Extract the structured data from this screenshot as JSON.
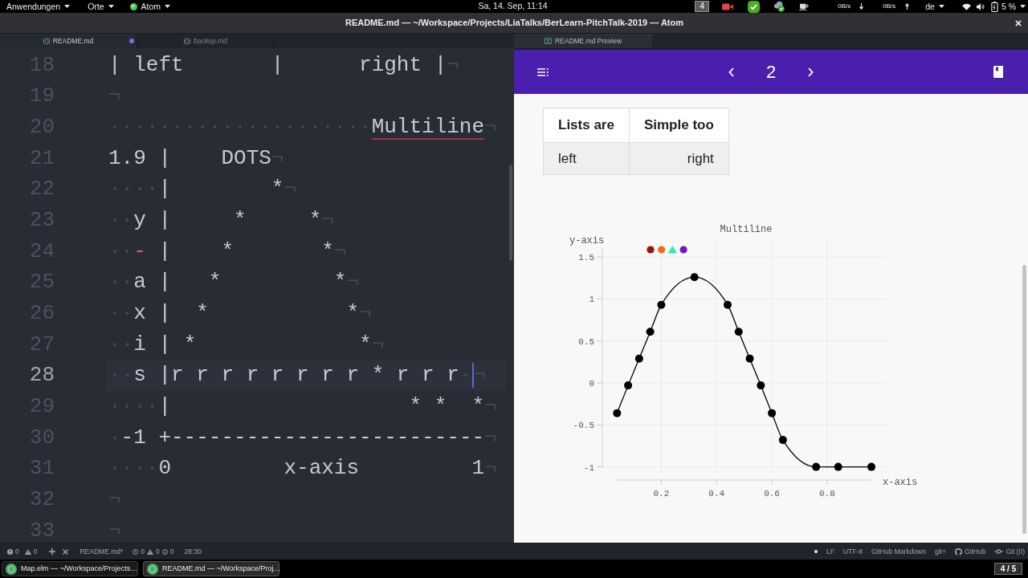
{
  "top_bar": {
    "menus": [
      {
        "label": "Anwendungen",
        "kind": "plain"
      },
      {
        "label": "Orte",
        "kind": "plain"
      },
      {
        "label": "Atom",
        "kind": "app"
      }
    ],
    "clock": "Sa, 14. Sep, 11:14",
    "workspace": "4",
    "download_rate": "0B/s",
    "upload_rate": "0B/s",
    "keyboard_layout": "de",
    "battery": "5 %"
  },
  "window": {
    "title": "README.md — ~/Workspace/Projects/LiaTalks/BerLearn-PitchTalk-2019 — Atom"
  },
  "editor": {
    "tabs": [
      {
        "label": "README.md",
        "selected": true,
        "modified": true,
        "pending": false
      },
      {
        "label": "backup.md",
        "selected": false,
        "modified": false,
        "pending": true
      }
    ],
    "lines": [
      {
        "number": "18",
        "current": false,
        "segments": [
          {
            "kind": "text",
            "text": "| left       |      right |"
          },
          {
            "kind": "eol",
            "text": "¬"
          }
        ]
      },
      {
        "number": "19",
        "current": false,
        "segments": [
          {
            "kind": "eol",
            "text": "¬"
          }
        ]
      },
      {
        "number": "20",
        "current": false,
        "segments": [
          {
            "kind": "ws",
            "text": "·····················"
          },
          {
            "kind": "flagged",
            "text": "Multiline"
          },
          {
            "kind": "eol",
            "text": "¬"
          }
        ]
      },
      {
        "number": "21",
        "current": false,
        "segments": [
          {
            "kind": "text",
            "text": "1.9 |    DOTS"
          },
          {
            "kind": "eol",
            "text": "¬"
          }
        ]
      },
      {
        "number": "22",
        "current": false,
        "segments": [
          {
            "kind": "ws",
            "text": "····"
          },
          {
            "kind": "text",
            "text": "|        *"
          },
          {
            "kind": "eol",
            "text": "¬"
          }
        ]
      },
      {
        "number": "23",
        "current": false,
        "segments": [
          {
            "kind": "ws",
            "text": "··"
          },
          {
            "kind": "text",
            "text": "y |     *     *"
          },
          {
            "kind": "eol",
            "text": "¬"
          }
        ]
      },
      {
        "number": "24",
        "current": false,
        "segments": [
          {
            "kind": "ws",
            "text": "··"
          },
          {
            "kind": "marker",
            "text": "-"
          },
          {
            "kind": "text",
            "text": " |    *       *"
          },
          {
            "kind": "eol",
            "text": "¬"
          }
        ]
      },
      {
        "number": "25",
        "current": false,
        "segments": [
          {
            "kind": "ws",
            "text": "··"
          },
          {
            "kind": "text",
            "text": "a |   *         *"
          },
          {
            "kind": "eol",
            "text": "¬"
          }
        ]
      },
      {
        "number": "26",
        "current": false,
        "segments": [
          {
            "kind": "ws",
            "text": "··"
          },
          {
            "kind": "text",
            "text": "x |  *           *"
          },
          {
            "kind": "eol",
            "text": "¬"
          }
        ]
      },
      {
        "number": "27",
        "current": false,
        "segments": [
          {
            "kind": "ws",
            "text": "··"
          },
          {
            "kind": "text",
            "text": "i | *             *"
          },
          {
            "kind": "eol",
            "text": "¬"
          }
        ]
      },
      {
        "number": "28",
        "current": true,
        "segments": [
          {
            "kind": "ws",
            "text": "··"
          },
          {
            "kind": "text",
            "text": "s |r r r r r r r r * r r r"
          },
          {
            "kind": "ws",
            "text": "·"
          },
          {
            "kind": "cursor"
          },
          {
            "kind": "eol",
            "text": "¬"
          }
        ]
      },
      {
        "number": "29",
        "current": false,
        "segments": [
          {
            "kind": "ws",
            "text": "····"
          },
          {
            "kind": "text",
            "text": "|                   * *  *"
          },
          {
            "kind": "eol",
            "text": "¬"
          }
        ]
      },
      {
        "number": "30",
        "current": false,
        "segments": [
          {
            "kind": "ws",
            "text": "·"
          },
          {
            "kind": "text",
            "text": "-1 +-------------------------"
          },
          {
            "kind": "eol",
            "text": "¬"
          }
        ]
      },
      {
        "number": "31",
        "current": false,
        "segments": [
          {
            "kind": "ws",
            "text": "····"
          },
          {
            "kind": "text",
            "text": "0         x-axis         1"
          },
          {
            "kind": "eol",
            "text": "¬"
          }
        ]
      },
      {
        "number": "32",
        "current": false,
        "segments": [
          {
            "kind": "eol",
            "text": "¬"
          }
        ]
      },
      {
        "number": "33",
        "current": false,
        "segments": [
          {
            "kind": "eol",
            "text": "¬"
          }
        ]
      }
    ]
  },
  "preview": {
    "tabs": [
      {
        "label": "README.md Preview",
        "selected": true
      }
    ],
    "slide": "2",
    "table": {
      "columns": [
        {
          "label": "Lists are",
          "right_aligned": false
        },
        {
          "label": "Simple too",
          "right_aligned": true
        }
      ],
      "rows": [
        [
          "left",
          "right"
        ]
      ]
    },
    "chart": {
      "legend": [
        {
          "kind": "circle",
          "color": "#a30d0d"
        },
        {
          "kind": "circle",
          "color": "#ee6e1c"
        },
        {
          "kind": "triangle",
          "color": "#2ee8b5"
        },
        {
          "kind": "circle",
          "color": "#7a12c4"
        }
      ],
      "chart_data": {
        "type": "line",
        "title": "Multiline",
        "xlabel": "x-axis",
        "ylabel": "y-axis",
        "x": [
          0.04,
          0.08,
          0.12,
          0.16,
          0.2,
          0.32,
          0.44,
          0.48,
          0.52,
          0.56,
          0.6,
          0.64,
          0.76,
          0.84,
          0.96
        ],
        "series": [
          {
            "color": "#000000",
            "marker": "circle",
            "values": [
              -0.36,
              -0.03,
              0.29,
              0.61,
              0.93,
              1.26,
              0.93,
              0.61,
              0.29,
              -0.03,
              -0.36,
              -0.68,
              -1,
              -1,
              -1
            ]
          }
        ],
        "xlim": [
          0.04,
          0.96
        ],
        "ylim": [
          -1,
          1.6
        ],
        "xticks": [
          0.2,
          0.4,
          0.6,
          0.8
        ],
        "yticks": [
          -1,
          -0.5,
          0,
          0.5,
          1,
          1.5
        ],
        "grid": true
      }
    }
  },
  "status_bar": {
    "left": [
      {
        "kind": "error",
        "text": "0"
      },
      {
        "kind": "warning",
        "text": "0"
      },
      {
        "kind": "add"
      },
      {
        "kind": "remove"
      },
      {
        "kind": "text",
        "text": "README.md*"
      },
      {
        "kind": "issue",
        "text": "0"
      },
      {
        "kind": "warning",
        "text": "0"
      },
      {
        "kind": "info",
        "text": "0"
      },
      {
        "kind": "text",
        "text": "28:30"
      }
    ],
    "right": [
      {
        "kind": "dot"
      },
      {
        "kind": "text",
        "text": "LF"
      },
      {
        "kind": "text",
        "text": "UTF-8"
      },
      {
        "kind": "text",
        "text": "GitHub Markdown"
      },
      {
        "kind": "text",
        "text": "git+"
      },
      {
        "kind": "github",
        "text": "GitHub"
      },
      {
        "kind": "commit",
        "text": "Git (0)"
      }
    ]
  },
  "taskbar": {
    "tasks": [
      {
        "label": "Map.elm — ~/Workspace/Projects…",
        "selected": false
      },
      {
        "label": "README.md — ~/Workspace/Proj…",
        "selected": true
      }
    ],
    "workspace": "4 / 5"
  }
}
